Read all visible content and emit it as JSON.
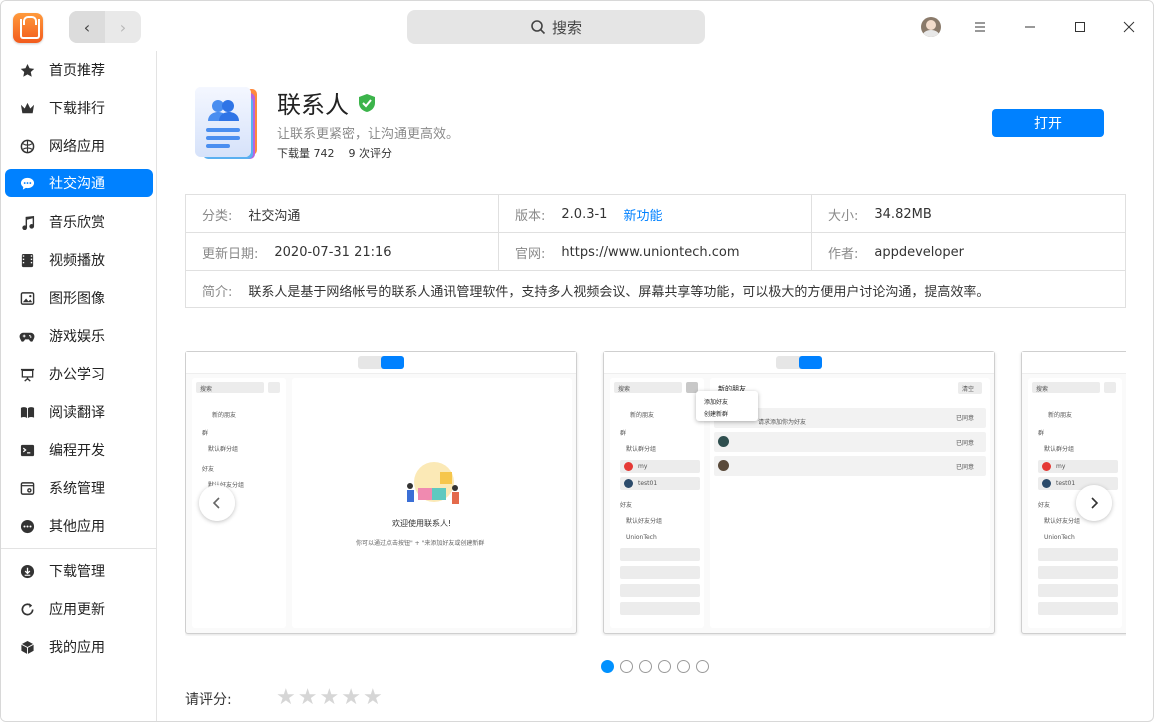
{
  "titlebar": {
    "back_label": "‹",
    "forward_label": "›",
    "search_label": "搜索",
    "menu_icon": "menu-icon",
    "min_icon": "minimize-icon",
    "max_icon": "maximize-icon",
    "close_icon": "close-icon"
  },
  "sidebar": {
    "items": [
      {
        "label": "首页推荐",
        "icon": "star-icon"
      },
      {
        "label": "下载排行",
        "icon": "crown-icon"
      },
      {
        "label": "网络应用",
        "icon": "globe-icon"
      },
      {
        "label": "社交沟通",
        "icon": "chat-icon",
        "active": true
      },
      {
        "label": "音乐欣赏",
        "icon": "music-icon"
      },
      {
        "label": "视频播放",
        "icon": "film-icon"
      },
      {
        "label": "图形图像",
        "icon": "image-icon"
      },
      {
        "label": "游戏娱乐",
        "icon": "gamepad-icon"
      },
      {
        "label": "办公学习",
        "icon": "presentation-icon"
      },
      {
        "label": "阅读翻译",
        "icon": "book-icon"
      },
      {
        "label": "编程开发",
        "icon": "terminal-icon"
      },
      {
        "label": "系统管理",
        "icon": "system-icon"
      },
      {
        "label": "其他应用",
        "icon": "more-icon"
      }
    ],
    "bottom_items": [
      {
        "label": "下载管理",
        "icon": "download-icon"
      },
      {
        "label": "应用更新",
        "icon": "update-icon"
      },
      {
        "label": "我的应用",
        "icon": "box-icon"
      }
    ]
  },
  "app": {
    "name": "联系人",
    "description": "让联系更紧密，让沟通更高效。",
    "downloads": "下载量 742",
    "ratings": "9 次评分",
    "open_label": "打开"
  },
  "info": {
    "category_label": "分类:",
    "category_value": "社交沟通",
    "version_label": "版本:",
    "version_value": "2.0.3-1",
    "new_features": "新功能",
    "size_label": "大小:",
    "size_value": "34.82MB",
    "updated_label": "更新日期:",
    "updated_value": "2020-07-31 21:16",
    "website_label": "官网:",
    "website_value": "https://www.uniontech.com",
    "author_label": "作者:",
    "author_value": "appdeveloper",
    "intro_label": "简介:",
    "intro_value": "联系人是基于网络帐号的联系人通讯管理软件，支持多人视频会议、屏幕共享等功能，可以极大的方便用户讨论沟通，提高效率。"
  },
  "screenshots": {
    "shot1": {
      "search": "搜索",
      "new_friends": "新的朋友",
      "group": "群",
      "default_group": "默认群分组",
      "friends": "好友",
      "default_friend_group": "默认好友分组",
      "welcome": "欢迎使用联系人!",
      "hint": "你可以通过点击按钮\" + \"来添加好友或创建新群"
    },
    "shot2": {
      "search": "搜索",
      "new_friends": "新的朋友",
      "header": "新的朋友",
      "clear": "清空",
      "menu_add_friend": "添加好友",
      "menu_create_group": "创建新群",
      "request_text": "请求添加你为好友",
      "agreed": "已同意",
      "group": "群",
      "default_group": "默认群分组",
      "contact_my": "my",
      "contact_test": "test01",
      "friends": "好友",
      "default_friend_group": "默认好友分组",
      "org": "UnionTech"
    },
    "shot3": {
      "search": "搜索",
      "new_friends": "新的朋友",
      "group": "群",
      "default_group": "默认群分组",
      "contact_my": "my",
      "contact_test": "test01",
      "friends": "好友",
      "default_friend_group": "默认好友分组",
      "org": "UnionTech"
    },
    "prev_icon": "chevron-left-icon",
    "next_icon": "chevron-right-icon",
    "page_count": 6,
    "active_page": 1
  },
  "rating": {
    "label": "请评分:",
    "stars": 5,
    "filled": 0
  },
  "colors": {
    "accent": "#0081ff",
    "verified": "#3cb44b"
  }
}
